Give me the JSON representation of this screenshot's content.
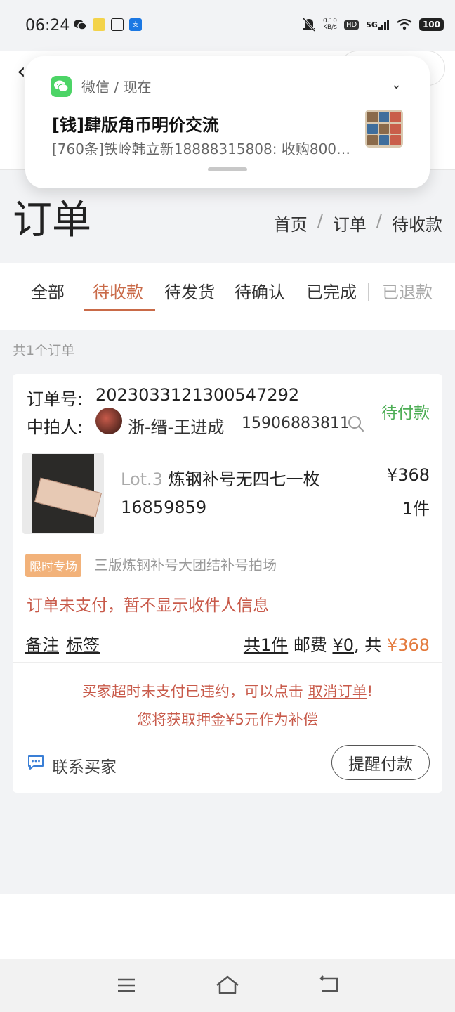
{
  "status_bar": {
    "time": "06:24",
    "net_speed_value": "0.10",
    "net_speed_unit": "KB/s",
    "hd_badge": "HD",
    "network": "5G",
    "battery": "100",
    "app_icons": [
      "wechat-icon",
      "news-app-icon",
      "toutiao-icon",
      "alipay-icon"
    ]
  },
  "notification": {
    "source": "微信 / 现在",
    "title": "[钱]肆版角币明价交流",
    "body": "[760条]铁岭韩立新18888315808: 收购800…"
  },
  "page": {
    "title": "订单",
    "breadcrumb": [
      "首页",
      "订单",
      "待收款"
    ],
    "breadcrumb_sep": "/"
  },
  "tabs": [
    {
      "label": "全部",
      "state": "normal"
    },
    {
      "label": "待收款",
      "state": "active"
    },
    {
      "label": "待发货",
      "state": "normal"
    },
    {
      "label": "待确认",
      "state": "normal"
    },
    {
      "label": "已完成",
      "state": "normal"
    },
    {
      "label": "已退款",
      "state": "disabled"
    }
  ],
  "order_count": "共1个订单",
  "order": {
    "order_no_label": "订单号:",
    "order_no": "2023033121300547292",
    "status": "待付款",
    "winner_label": "中拍人:",
    "winner_name": "浙-缙-王进成",
    "winner_phone": "15906883811",
    "lot_no": "Lot.3",
    "lot_title": "炼钢补号无四七一枚 16859859",
    "price": "¥368",
    "qty": "1件",
    "tag_limited": "限时专场",
    "session_name": "三版炼钢补号大团结补号拍场",
    "unpaid_note": "订单未支付，暂不显示收件人信息",
    "remark_link": "备注",
    "tag_link": "标签",
    "sum_count": "共1件",
    "sum_shipping_label": "邮费",
    "sum_shipping": "¥0",
    "sum_total_label": ", 共",
    "sum_total": "¥368",
    "warn_prefix": "买家超时未支付已违约，可以点击",
    "warn_cancel": "取消订单",
    "warn_suffix": "!",
    "warn_line2": "您将获取押金¥5元作为补偿",
    "contact_label": "联系买家",
    "remind_button": "提醒付款"
  },
  "colors": {
    "accent": "#c96a48",
    "status_green": "#4eae56",
    "warning_red": "#c85a4a",
    "price_orange": "#e37a3d",
    "tag_orange": "#f2b27a"
  }
}
